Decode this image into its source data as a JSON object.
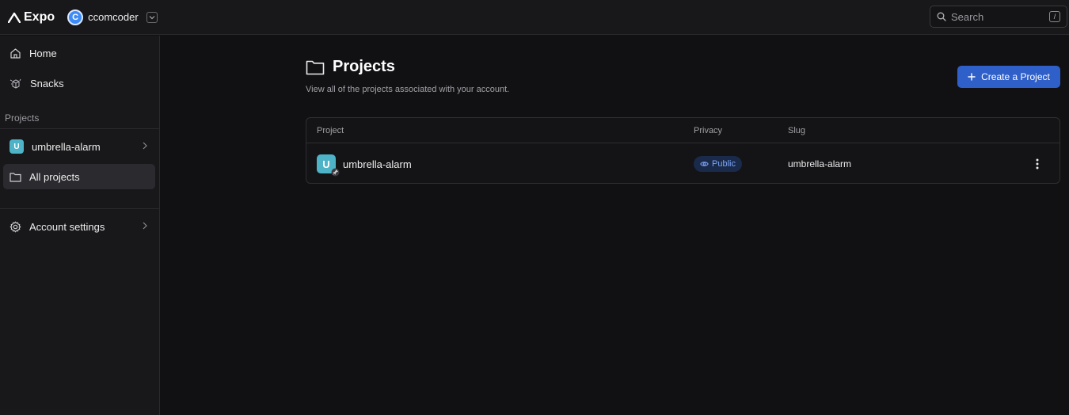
{
  "app": {
    "brand": "Expo"
  },
  "account": {
    "initial": "C",
    "name": "ccomcoder"
  },
  "search": {
    "placeholder": "Search",
    "shortcut": "/"
  },
  "sidebar": {
    "home_label": "Home",
    "snacks_label": "Snacks",
    "section_projects": "Projects",
    "project_item": {
      "initial": "U",
      "label": "umbrella-alarm"
    },
    "all_projects_label": "All projects",
    "account_settings_label": "Account settings"
  },
  "main": {
    "title": "Projects",
    "subtitle": "View all of the projects associated with your account.",
    "create_label": "Create a Project",
    "table": {
      "headers": {
        "project": "Project",
        "privacy": "Privacy",
        "slug": "Slug"
      },
      "rows": [
        {
          "initial": "U",
          "name": "umbrella-alarm",
          "privacy": "Public",
          "slug": "umbrella-alarm"
        }
      ]
    }
  },
  "colors": {
    "accent": "#2f5fc9",
    "project_badge": "#4fb3c8",
    "public_badge_bg": "#1a2a4a",
    "public_badge_text": "#7ea6f6"
  }
}
